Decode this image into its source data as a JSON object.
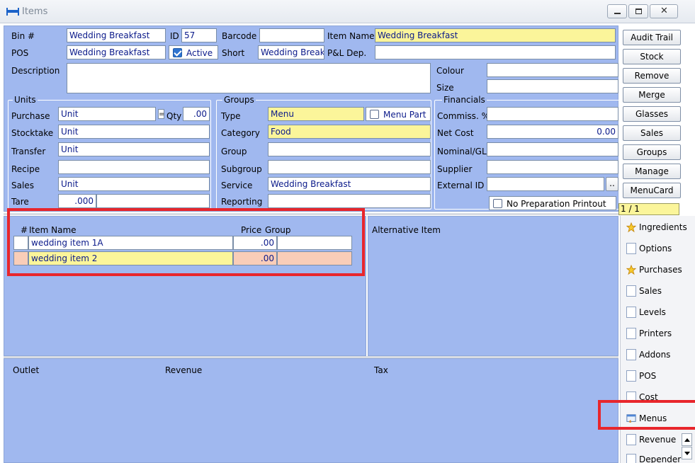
{
  "window": {
    "title": "Items",
    "controls": [
      "minimize",
      "maximize",
      "close"
    ]
  },
  "header": {
    "bin_label": "Bin #",
    "bin_value": "Wedding Breakfast",
    "id_label": "ID",
    "id_value": "57",
    "barcode_label": "Barcode",
    "barcode_value": "",
    "item_name_label": "Item Name",
    "item_name_value": "Wedding Breakfast",
    "pos_label": "POS",
    "pos_value": "Wedding Breakfast",
    "active_label": "Active",
    "active_checked": true,
    "short_label": "Short",
    "short_value": "Wedding Break",
    "pl_dep_label": "P&L Dep.",
    "pl_dep_value": "",
    "description_label": "Description",
    "description_value": "",
    "colour_label": "Colour",
    "colour_value": "",
    "size_label": "Size",
    "size_value": ""
  },
  "units": {
    "title": "Units",
    "purchase_label": "Purchase",
    "purchase_value": "Unit",
    "eq_symbol": "=",
    "qty_label": "Qty",
    "qty_value": ".00",
    "stocktake_label": "Stocktake",
    "stocktake_value": "Unit",
    "transfer_label": "Transfer",
    "transfer_value": "Unit",
    "recipe_label": "Recipe",
    "recipe_value": "",
    "sales_label": "Sales",
    "sales_value": "Unit",
    "tare_label": "Tare",
    "tare_value": ".000"
  },
  "groups": {
    "title": "Groups",
    "type_label": "Type",
    "type_value": "Menu",
    "menu_part_label": "Menu Part",
    "menu_part_checked": false,
    "category_label": "Category",
    "category_value": "Food",
    "group_label": "Group",
    "group_value": "",
    "subgroup_label": "Subgroup",
    "subgroup_value": "",
    "service_label": "Service",
    "service_value": "Wedding Breakfast",
    "reporting_label": "Reporting",
    "reporting_value": ""
  },
  "financials": {
    "title": "Financials",
    "commiss_label": "Commiss. %",
    "commiss_value": "",
    "net_cost_label": "Net Cost",
    "net_cost_value": "0.00",
    "nominal_label": "Nominal/GL",
    "nominal_value": "",
    "supplier_label": "Supplier",
    "supplier_value": "",
    "external_id_label": "External ID",
    "external_id_value": "",
    "external_id_btn": "..",
    "no_prep_label": "No Preparation Printout",
    "no_prep_checked": false
  },
  "actions": {
    "audit_trail": "Audit Trail",
    "stock": "Stock",
    "remove": "Remove",
    "merge": "Merge",
    "glasses": "Glasses",
    "sales": "Sales",
    "groups": "Groups",
    "manage": "Manage",
    "menucard": "MenuCard",
    "pager": "1 / 1"
  },
  "menu_items": {
    "col_hash": "#",
    "col_item_name": "Item Name",
    "col_price": "Price",
    "col_group": "Group",
    "rows": [
      {
        "name": "wedding item 1A",
        "price": ".00",
        "group": ""
      },
      {
        "name": "wedding item 2",
        "price": ".00",
        "group": ""
      }
    ]
  },
  "alternative": {
    "title": "Alternative Item"
  },
  "revenue_table": {
    "col_outlet": "Outlet",
    "col_revenue": "Revenue",
    "col_tax": "Tax"
  },
  "side_tabs": [
    {
      "label": "Ingredients",
      "icon": "star-icon"
    },
    {
      "label": "Options",
      "icon": "document-icon"
    },
    {
      "label": "Purchases",
      "icon": "star-icon"
    },
    {
      "label": "Sales",
      "icon": "document-icon"
    },
    {
      "label": "Levels",
      "icon": "document-icon"
    },
    {
      "label": "Printers",
      "icon": "document-icon"
    },
    {
      "label": "Addons",
      "icon": "document-icon"
    },
    {
      "label": "POS",
      "icon": "document-icon"
    },
    {
      "label": "Cost",
      "icon": "document-icon"
    },
    {
      "label": "Menus",
      "icon": "menu-window-icon"
    },
    {
      "label": "Revenue",
      "icon": "document-icon"
    },
    {
      "label": "Depender",
      "icon": "document-icon"
    }
  ],
  "colors": {
    "panel_blue": "#a0b8ef",
    "highlight_yellow": "#fbf59a",
    "selected_row_pink": "#f9cdb8",
    "annotation_red": "#e8262c"
  }
}
